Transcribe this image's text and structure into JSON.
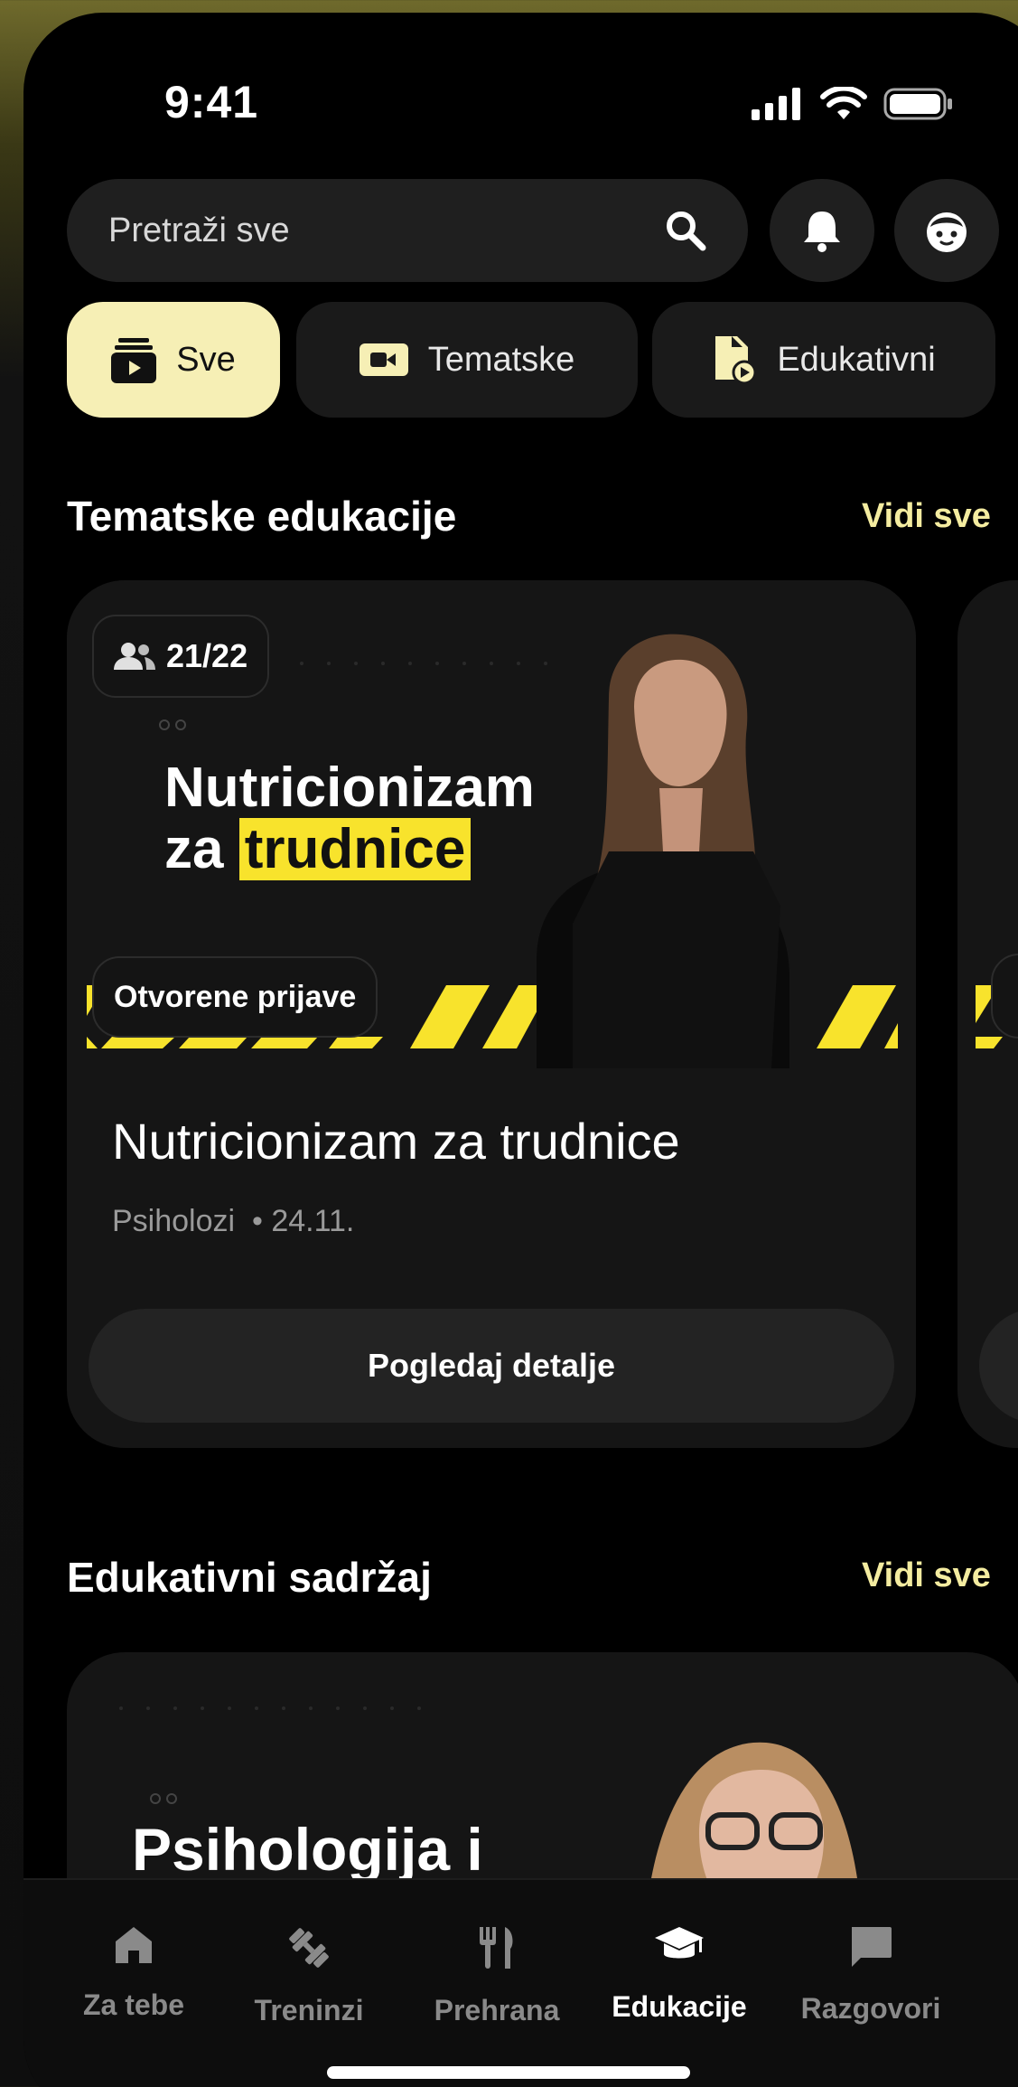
{
  "status": {
    "time": "9:41"
  },
  "search": {
    "placeholder": "Pretraži sve"
  },
  "tabs": [
    {
      "label": "Sve",
      "active": true,
      "icon": "play-stack-icon"
    },
    {
      "label": "Tematske",
      "active": false,
      "icon": "video-icon"
    },
    {
      "label": "Edukativni",
      "active": false,
      "icon": "doc-play-icon"
    }
  ],
  "sections": {
    "thematic": {
      "title": "Tematske edukacije",
      "link": "Vidi sve"
    },
    "educational": {
      "title": "Edukativni sadržaj",
      "link": "Vidi sve"
    }
  },
  "card": {
    "participants": "21/22",
    "banner_line1": "Nutricionizam",
    "banner_line2_prefix": "za",
    "banner_line2_highlight": "trudnice",
    "status_badge": "Otvorene prijave",
    "title": "Nutricionizam za trudnice",
    "category": "Psiholozi",
    "date": "24.11.",
    "button": "Pogledaj detalje"
  },
  "card3": {
    "banner_text": "Psihologija i"
  },
  "nav": [
    {
      "label": "Za tebe",
      "icon": "home-icon",
      "active": false
    },
    {
      "label": "Treninzi",
      "icon": "dumbbell-icon",
      "active": false
    },
    {
      "label": "Prehrana",
      "icon": "fork-knife-icon",
      "active": false
    },
    {
      "label": "Edukacije",
      "icon": "graduation-cap-icon",
      "active": true
    },
    {
      "label": "Razgovori",
      "icon": "chat-icon",
      "active": false
    }
  ],
  "colors": {
    "accent": "#f6efb5",
    "highlight": "#f8e32c",
    "link": "#f4eca0",
    "background": "#000000"
  }
}
